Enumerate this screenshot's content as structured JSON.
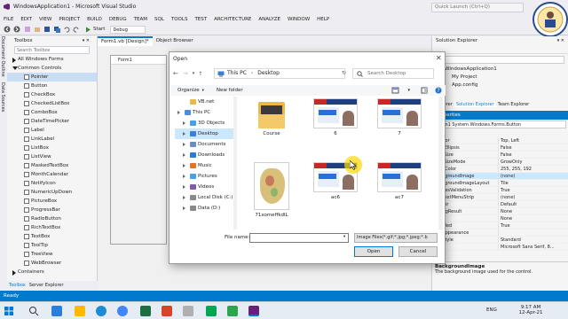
{
  "window": {
    "title": "WindowsApplication1 - Microsoft Visual Studio",
    "quick_launch": "Quick Launch (Ctrl+Q)"
  },
  "menu": [
    "FILE",
    "EDIT",
    "VIEW",
    "PROJECT",
    "BUILD",
    "DEBUG",
    "TEAM",
    "SQL",
    "TOOLS",
    "TEST",
    "ARCHITECTURE",
    "ANALYZE",
    "WINDOW",
    "HELP"
  ],
  "toolbar": {
    "start_label": "Start",
    "config": "Debug"
  },
  "vtabs": [
    "Document Outline",
    "Data Sources"
  ],
  "toolbox": {
    "title": "Toolbox",
    "search_placeholder": "Search Toolbox",
    "groups": [
      {
        "label": "All Windows Forms",
        "collapsed": true
      },
      {
        "label": "Common Controls",
        "collapsed": false
      }
    ],
    "items": [
      "Pointer",
      "Button",
      "CheckBox",
      "CheckedListBox",
      "ComboBox",
      "DateTimePicker",
      "Label",
      "LinkLabel",
      "ListBox",
      "ListView",
      "MaskedTextBox",
      "MonthCalendar",
      "NotifyIcon",
      "NumericUpDown",
      "PictureBox",
      "ProgressBar",
      "RadioButton",
      "RichTextBox",
      "TextBox",
      "ToolTip",
      "TreeView",
      "WebBrowser"
    ],
    "footer_group": "Containers",
    "tabs": [
      "Toolbox",
      "Server Explorer"
    ]
  },
  "doctabs": [
    "Form1.vb [Design]*",
    "Object Browser"
  ],
  "form": {
    "caption": "Form1"
  },
  "solution_explorer": {
    "title": "Solution Explorer",
    "items": [
      "WindowsApplication1",
      "My Project",
      "App.config"
    ],
    "tabs": [
      "Explorer",
      "Solution Explorer",
      "Team Explorer"
    ]
  },
  "properties": {
    "title": "Properties",
    "object": "Form1 System.Windows.Forms.Button",
    "rows": [
      {
        "name": "Anchor",
        "value": "Top, Left"
      },
      {
        "name": "AutoEllipsis",
        "value": "False"
      },
      {
        "name": "AutoSize",
        "value": "False"
      },
      {
        "name": "AutoSizeMode",
        "value": "GrowOnly"
      },
      {
        "name": "BackColor",
        "value": "255, 255, 192"
      },
      {
        "name": "BackgroundImage",
        "value": "(none)"
      },
      {
        "name": "BackgroundImageLayout",
        "value": "Tile"
      },
      {
        "name": "CausesValidation",
        "value": "True"
      },
      {
        "name": "ContextMenuStrip",
        "value": "(none)"
      },
      {
        "name": "Cursor",
        "value": "Default"
      },
      {
        "name": "DialogResult",
        "value": "None"
      },
      {
        "name": "Dock",
        "value": "None"
      },
      {
        "name": "Enabled",
        "value": "True"
      },
      {
        "name": "FlatAppearance",
        "value": ""
      },
      {
        "name": "FlatStyle",
        "value": "Standard"
      },
      {
        "name": "Font",
        "value": "Microsoft Sans Serif, 8..."
      }
    ],
    "desc_title": "BackgroundImage",
    "desc_text": "The background image used for the control."
  },
  "status": {
    "text": "Ready"
  },
  "dialog": {
    "title": "Open",
    "path": [
      "This PC",
      "Desktop"
    ],
    "search_placeholder": "Search Desktop",
    "organize": "Organize",
    "new_folder": "New folder",
    "nav": [
      {
        "label": "VB.net",
        "color": "#e8b84a",
        "level": 1,
        "selected": false,
        "caret": false
      },
      {
        "label": "This PC",
        "color": "#4a90d9",
        "level": 0,
        "selected": false,
        "caret": true
      },
      {
        "label": "3D Objects",
        "color": "#4aa0e0",
        "level": 1,
        "selected": false,
        "caret": true
      },
      {
        "label": "Desktop",
        "color": "#3d7fd6",
        "level": 1,
        "selected": true,
        "caret": true
      },
      {
        "label": "Documents",
        "color": "#6c8ebf",
        "level": 1,
        "selected": false,
        "caret": true
      },
      {
        "label": "Downloads",
        "color": "#2e7bd6",
        "level": 1,
        "selected": false,
        "caret": true
      },
      {
        "label": "Music",
        "color": "#e0742b",
        "level": 1,
        "selected": false,
        "caret": true
      },
      {
        "label": "Pictures",
        "color": "#4aa0e0",
        "level": 1,
        "selected": false,
        "caret": true
      },
      {
        "label": "Videos",
        "color": "#7b5ea7",
        "level": 1,
        "selected": false,
        "caret": true
      },
      {
        "label": "Local Disk (C:)",
        "color": "#8a8a8a",
        "level": 1,
        "selected": false,
        "caret": true
      },
      {
        "label": "Data (D:)",
        "color": "#8a8a8a",
        "level": 1,
        "selected": false,
        "caret": true
      }
    ],
    "files": [
      {
        "name": "Course",
        "kind": "folder"
      },
      {
        "name": "6",
        "kind": "video"
      },
      {
        "name": "7",
        "kind": "video"
      },
      {
        "name": "71xomeffkdlL",
        "kind": "map"
      },
      {
        "name": "ac6",
        "kind": "video2"
      },
      {
        "name": "ac7",
        "kind": "video2"
      }
    ],
    "file_name_label": "File name:",
    "file_name_value": "",
    "file_type": "Image Files(*.gif;*.jpg;*.jpeg;*.b",
    "open_label": "Open",
    "cancel_label": "Cancel"
  },
  "taskbar": {
    "time": "9:17 AM",
    "date": "12-Apr-21",
    "language": "ENG"
  },
  "colors": {
    "accent": "#007acc",
    "selected": "#cce8ff",
    "statusbar": "#007acc"
  }
}
